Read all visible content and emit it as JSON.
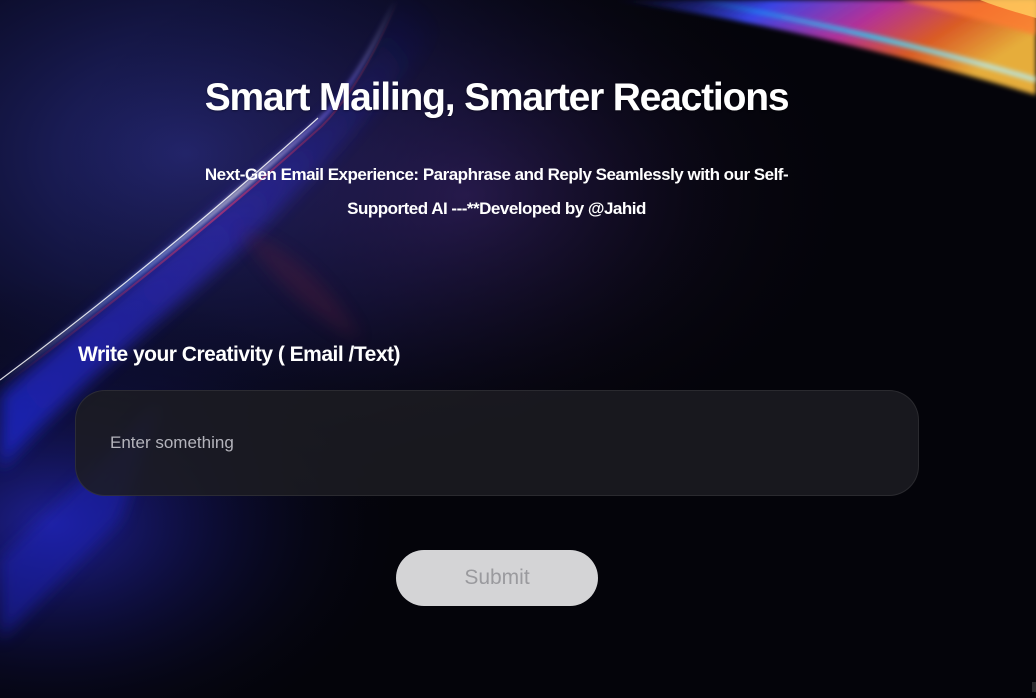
{
  "hero": {
    "title": "Smart Mailing, Smarter Reactions",
    "subtitle": "Next-Gen Email Experience: Paraphrase and Reply Seamlessly with our Self-Supported AI ---**Developed by @Jahid"
  },
  "form": {
    "label": "Write your Creativity ( Email /Text)",
    "input_value": "",
    "input_placeholder": "Enter something",
    "submit_label": "Submit"
  },
  "colors": {
    "background": "#04040a",
    "input_background": "#1c1c22",
    "button_background": "#d4d4d6",
    "button_text": "#9a9a9e",
    "accent_blue": "#2a3cff",
    "accent_magenta": "#c02a9a"
  }
}
